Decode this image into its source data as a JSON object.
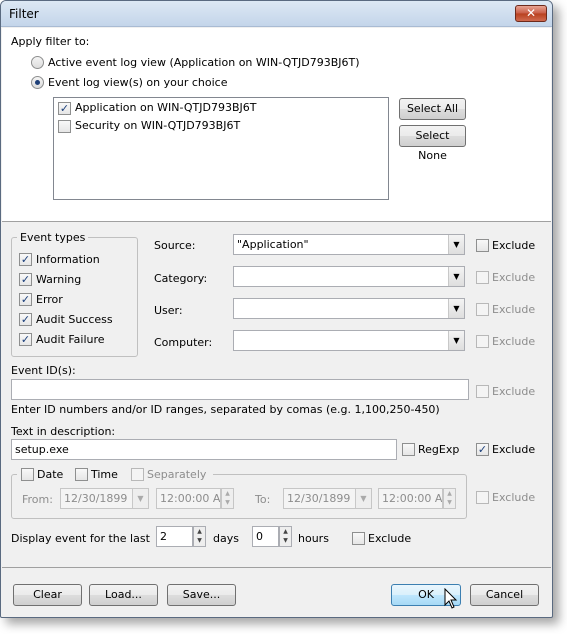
{
  "window": {
    "title": "Filter",
    "close_glyph": "✕"
  },
  "apply": {
    "heading": "Apply filter to:",
    "radio_active": "Active event log view (Application on WIN-QTJD793BJ6T)",
    "radio_views": "Event log view(s) on your choice",
    "views": [
      {
        "label": "Application on WIN-QTJD793BJ6T",
        "checked": true
      },
      {
        "label": "Security on WIN-QTJD793BJ6T",
        "checked": false
      }
    ],
    "select_all": "Select All",
    "select_none": "Select None"
  },
  "event_types": {
    "title": "Event types",
    "items": [
      "Information",
      "Warning",
      "Error",
      "Audit Success",
      "Audit Failure"
    ]
  },
  "fields": {
    "source_label": "Source:",
    "source_value": "\"Application\"",
    "category_label": "Category:",
    "user_label": "User:",
    "computer_label": "Computer:",
    "exclude": "Exclude"
  },
  "event_id": {
    "label": "Event ID(s):",
    "hint": "Enter ID numbers and/or ID ranges, separated by comas (e.g. 1,100,250-450)",
    "exclude": "Exclude"
  },
  "description": {
    "label": "Text in description:",
    "value": "setup.exe",
    "regexp": "RegExp",
    "exclude": "Exclude"
  },
  "datetime": {
    "date_label": "Date",
    "time_label": "Time",
    "separately_label": "Separately",
    "from_label": "From:",
    "to_label": "To:",
    "from_date": "12/30/1899",
    "from_time": "12:00:00 AM",
    "to_date": "12/30/1899",
    "to_time": "12:00:00 AM",
    "exclude": "Exclude"
  },
  "last": {
    "label": "Display event for the last",
    "days_value": "2",
    "days_label": "days",
    "hours_value": "0",
    "hours_label": "hours",
    "exclude": "Exclude"
  },
  "buttons": {
    "clear": "Clear",
    "load": "Load...",
    "save": "Save...",
    "ok": "OK",
    "cancel": "Cancel"
  },
  "icons": {
    "close": "close-icon",
    "dropdown": "chevron-down-icon",
    "spin": "spin-arrows-icon",
    "cursor": "mouse-pointer-icon"
  }
}
